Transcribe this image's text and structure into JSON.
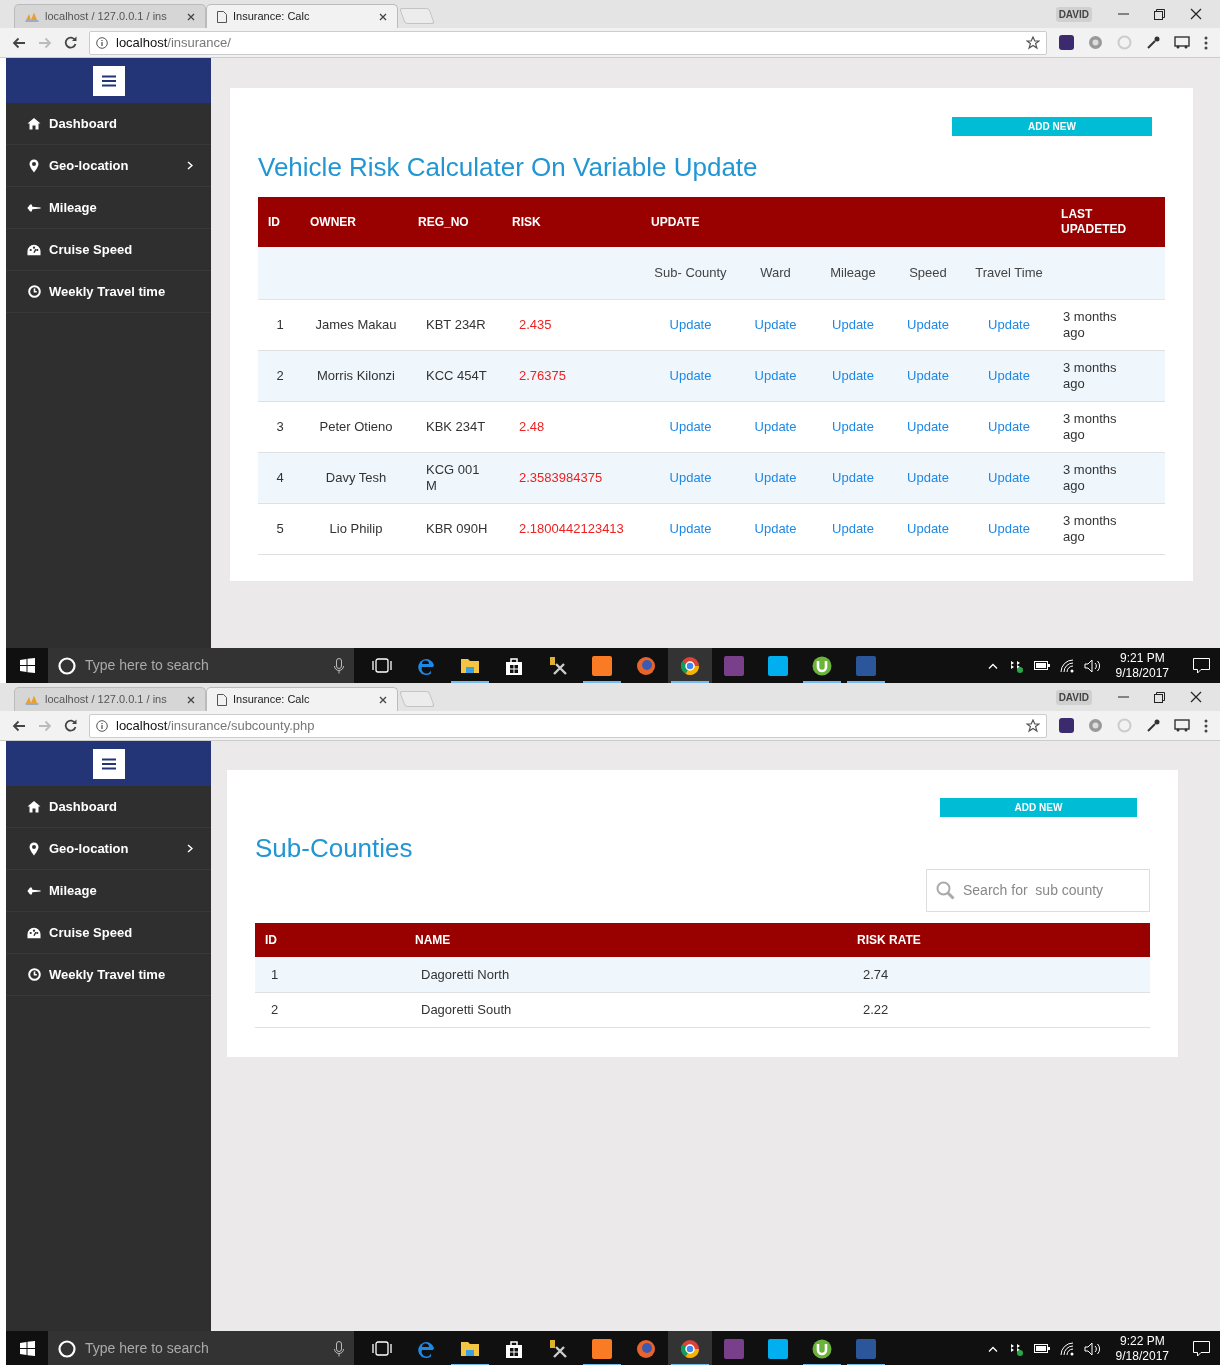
{
  "screens": [
    {
      "browser": {
        "tabs": [
          {
            "title": "localhost / 127.0.0.1 / ins",
            "selected": false
          },
          {
            "title": "Insurance: Calc",
            "selected": true
          }
        ],
        "user": "DAVID",
        "url_host": "localhost",
        "url_path": "/insurance/"
      },
      "sidebar": {
        "items": [
          {
            "label": "Dashboard",
            "has_submenu": false
          },
          {
            "label": "Geo-location",
            "has_submenu": true
          },
          {
            "label": "Mileage",
            "has_submenu": false
          },
          {
            "label": "Cruise Speed",
            "has_submenu": false
          },
          {
            "label": "Weekly Travel time",
            "has_submenu": false
          }
        ]
      },
      "page": {
        "kind": "risk",
        "add_button": "ADD NEW",
        "title": "Vehicle Risk Calculater On Variable Update",
        "columns": [
          "ID",
          "OWNER",
          "REG_NO",
          "RISK",
          "UPDATE",
          "LAST UPADETED"
        ],
        "update_columns": [
          "Sub- County",
          "Ward",
          "Mileage",
          "Speed",
          "Travel Time"
        ],
        "rows": [
          {
            "id": "1",
            "owner": "James Makau",
            "reg_no": "KBT 234R",
            "risk": "2.435",
            "updates": [
              "Update",
              "Update",
              "Update",
              "Update",
              "Update"
            ],
            "last_updated": "3 months ago"
          },
          {
            "id": "2",
            "owner": "Morris Kilonzi",
            "reg_no": "KCC 454T",
            "risk": "2.76375",
            "updates": [
              "Update",
              "Update",
              "Update",
              "Update",
              "Update"
            ],
            "last_updated": "3 months ago"
          },
          {
            "id": "3",
            "owner": "Peter Otieno",
            "reg_no": "KBK 234T",
            "risk": "2.48",
            "updates": [
              "Update",
              "Update",
              "Update",
              "Update",
              "Update"
            ],
            "last_updated": "3 months ago"
          },
          {
            "id": "4",
            "owner": "Davy Tesh",
            "reg_no": "KCG 001 M",
            "risk": "2.3583984375",
            "updates": [
              "Update",
              "Update",
              "Update",
              "Update",
              "Update"
            ],
            "last_updated": "3 months ago"
          },
          {
            "id": "5",
            "owner": "Lio Philip",
            "reg_no": "KBR 090H",
            "risk": "2.1800442123413",
            "updates": [
              "Update",
              "Update",
              "Update",
              "Update",
              "Update"
            ],
            "last_updated": "3 months ago"
          }
        ]
      },
      "taskbar": {
        "search_placeholder": "Type here to search",
        "time": "9:21 PM",
        "date": "9/18/2017"
      }
    },
    {
      "browser": {
        "tabs": [
          {
            "title": "localhost / 127.0.0.1 / ins",
            "selected": false
          },
          {
            "title": "Insurance: Calc",
            "selected": true
          }
        ],
        "user": "DAVID",
        "url_host": "localhost",
        "url_path": "/insurance/subcounty.php"
      },
      "sidebar": {
        "items": [
          {
            "label": "Dashboard",
            "has_submenu": false
          },
          {
            "label": "Geo-location",
            "has_submenu": true
          },
          {
            "label": "Mileage",
            "has_submenu": false
          },
          {
            "label": "Cruise Speed",
            "has_submenu": false
          },
          {
            "label": "Weekly Travel time",
            "has_submenu": false
          }
        ]
      },
      "page": {
        "kind": "subcounties",
        "add_button": "ADD NEW",
        "title": "Sub-Counties",
        "search_placeholder": "Search for  sub county",
        "columns": [
          "ID",
          "NAME",
          "RISK RATE"
        ],
        "rows": [
          {
            "id": "1",
            "name": "Dagoretti North",
            "risk_rate": "2.74"
          },
          {
            "id": "2",
            "name": "Dagoretti South",
            "risk_rate": "2.22"
          }
        ]
      },
      "taskbar": {
        "search_placeholder": "Type here to search",
        "time": "9:22 PM",
        "date": "9/18/2017"
      }
    }
  ]
}
